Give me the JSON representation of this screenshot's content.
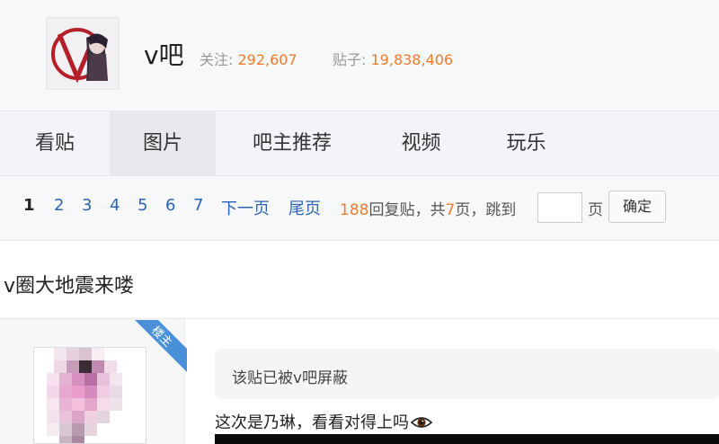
{
  "header": {
    "forum_name": "v吧",
    "follow_label": "关注:",
    "follow_count": "292,607",
    "posts_label": "贴子:",
    "posts_count": "19,838,406",
    "logo_icon": "forum-logo-icon"
  },
  "nav": {
    "tabs": [
      {
        "label": "看贴",
        "active": false
      },
      {
        "label": "图片",
        "active": true
      },
      {
        "label": "吧主推荐",
        "active": false
      },
      {
        "label": "视频",
        "active": false
      },
      {
        "label": "玩乐",
        "active": false
      }
    ]
  },
  "pager": {
    "current": "1",
    "pages": [
      "2",
      "3",
      "4",
      "5",
      "6",
      "7"
    ],
    "next": "下一页",
    "last": "尾页",
    "reply_count": "188",
    "reply_text": "回复贴，共",
    "total_pages": "7",
    "pages_suffix": "页，跳到",
    "goto_value": "",
    "page_unit": "页",
    "confirm_label": "确定"
  },
  "thread": {
    "title": "v圈大地震来喽"
  },
  "post": {
    "badge": "楼主",
    "notice": "该贴已被v吧屏蔽",
    "content": "这次是乃琳，看看对得上吗",
    "content_icon": "eye-icon"
  },
  "colors": {
    "accent_orange": "#f07b2e",
    "link_blue": "#2d64b3",
    "badge_blue": "#4a90d9"
  }
}
